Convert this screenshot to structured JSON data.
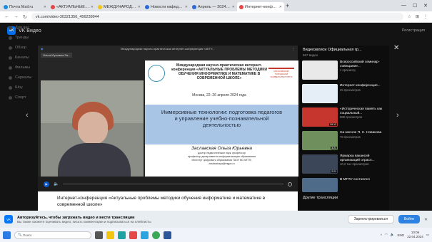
{
  "browser": {
    "tabs": [
      {
        "label": "Почта Mail.ru",
        "color": "#168de2"
      },
      {
        "label": "«АКТУАЛЬНЫЕ ПРОБЛЕМ",
        "color": "#e64646"
      },
      {
        "label": "МЕЖДУНАРОДНАЯ НАУ",
        "color": "#f2c511"
      },
      {
        "label": "Новости кафедры ТМОМ",
        "color": "#2a6bd8"
      },
      {
        "label": "Апрель — 2024 | Новости",
        "color": "#2a6bd8"
      },
      {
        "label": "Интернет-конференция",
        "color": "#e64646"
      }
    ],
    "url": "vk.com/video-30321356_456239944"
  },
  "vk": {
    "logo": "VK Видео",
    "register": "Регистрация",
    "nav": [
      "Для вас",
      "Тренды",
      "Обзор",
      "Каналы",
      "Фильмы",
      "Сериалы",
      "Шоу",
      "Спорт"
    ]
  },
  "player": {
    "tag": "Ольга Юрьевна За...",
    "top_title": "Международная научно-практическая интернет-конференция «АКТУ...",
    "camera_label": "Ольга Юрьевна Заславская",
    "slide": {
      "title": "Международная научно-практическая интернет-конференция «АКТУАЛЬНЫЕ ПРОБЛЕМЫ МЕТОДИКИ ОБУЧЕНИЯ ИНФОРМАТИКЕ И МАТЕМАТИКЕ В СОВРЕМЕННОЙ ШКОЛЕ»",
      "logo_right": "МОСКОВСКИЙ ГОРОДСКОЙ УНИВЕРСИТЕТ МГПУ",
      "date": "Москва, 22–26 апреля 2024 года",
      "topic": "Иммерсивные технологии: подготовка педагогов и управление учебно-познавательной деятельностью",
      "author": "Заславская Ольга Юрьевна",
      "desc1": "доктор педагогических наук, профессор",
      "desc2": "профессор департамента информатизации образования",
      "desc3": "Институт цифрового образования ГАОУ ВО МГПУ,",
      "email": "zaslavskaya@mgpu.ru"
    }
  },
  "video_title": "Интернет-конференция «Актуальные проблемы методики обучения информатике и математике в современной школе»",
  "panel": {
    "channel": "Видеозаписи Официальная гр...",
    "count": "567 видео",
    "items": [
      {
        "title": "Всероссийский семинар-совещание...",
        "views": "1 просмотр",
        "dur": "",
        "thumb": "#e9e9e9"
      },
      {
        "title": "Интернет-конференция...",
        "views": "29 просмотров",
        "dur": "",
        "thumb": "#e5eef6"
      },
      {
        "title": "«Историческая память как социальный...",
        "views": "888 просмотров",
        "dur": "09:12",
        "thumb": "#c7352f"
      },
      {
        "title": "На могиле П. С. Новикова",
        "views": "78 просмотров",
        "dur": "3:21",
        "thumb": "#6f8f5c"
      },
      {
        "title": "Ярмарка вакансий организаций отрасл...",
        "views": "10,2 тыс просмотров",
        "dur": "2:21",
        "thumb": "#3b4658"
      },
      {
        "title": "В МГПУ состоялся",
        "views": "",
        "dur": "",
        "thumb": "#4e6b8a"
      }
    ],
    "other": "Другие трансляции"
  },
  "banner": {
    "title": "Авторизуйтесь, чтобы загружать видео и вести трансляции",
    "text": "Вы также сможете оценивать видео, писать комментарии и подписываться на плейлисты",
    "btn1": "Зарегистрироваться",
    "btn2": "Войти"
  },
  "taskbar": {
    "search": "Поиск",
    "lang": "ENG",
    "time": "10:06",
    "date": "22.04.2024"
  }
}
